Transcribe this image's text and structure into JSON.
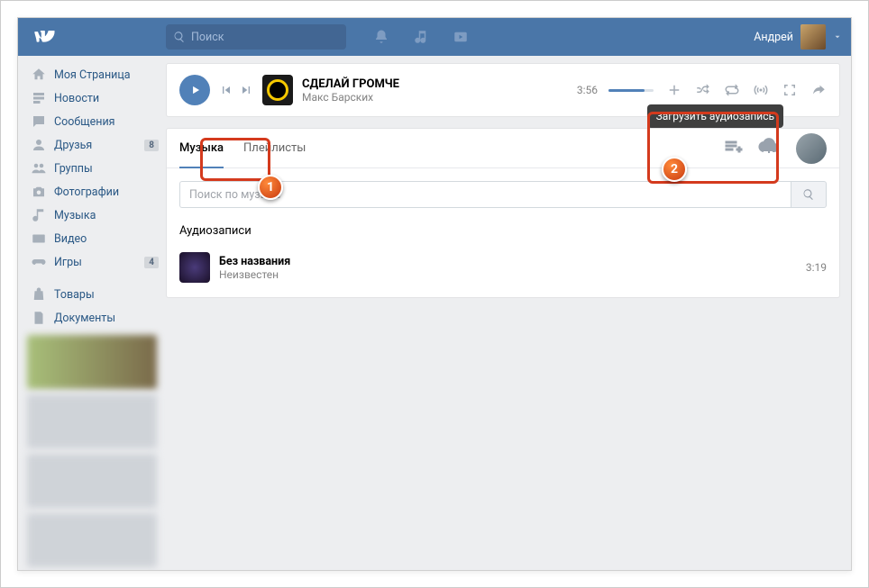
{
  "topbar": {
    "search_placeholder": "Поиск",
    "username": "Андрей"
  },
  "sidebar": {
    "items": [
      {
        "label": "Моя Страница"
      },
      {
        "label": "Новости"
      },
      {
        "label": "Сообщения"
      },
      {
        "label": "Друзья",
        "badge": "8"
      },
      {
        "label": "Группы"
      },
      {
        "label": "Фотографии"
      },
      {
        "label": "Музыка"
      },
      {
        "label": "Видео"
      },
      {
        "label": "Игры",
        "badge": "4"
      },
      {
        "label": "Товары"
      },
      {
        "label": "Документы"
      }
    ]
  },
  "player": {
    "track_title": "СДЕЛАЙ ГРОМЧЕ",
    "track_artist": "Макс Барских",
    "track_time": "3:56"
  },
  "music": {
    "tab_music": "Музыка",
    "tab_playlists": "Плейлисты",
    "upload_tooltip": "Загрузить аудиозапись",
    "search_placeholder": "Поиск по музыке",
    "section_title": "Аудиозаписи",
    "tracks": [
      {
        "title": "Без названия",
        "artist": "Неизвестен",
        "time": "3:19"
      }
    ]
  },
  "annotations": {
    "n1": "1",
    "n2": "2"
  }
}
